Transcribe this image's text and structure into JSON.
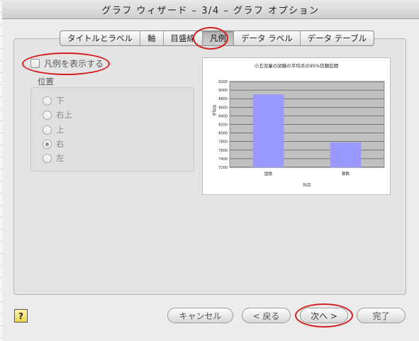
{
  "window": {
    "title": "グラフ ウィザード – 3/4 – グラフ オプション"
  },
  "tabs": [
    {
      "label": "タイトルとラベル"
    },
    {
      "label": "軸"
    },
    {
      "label": "目盛線"
    },
    {
      "label": "凡例"
    },
    {
      "label": "データ ラベル"
    },
    {
      "label": "データ テーブル"
    }
  ],
  "active_tab": "凡例",
  "legend_options": {
    "show_legend_label": "凡例を表示する",
    "show_legend_checked": false,
    "position_group_label": "位置",
    "positions": [
      {
        "label": "下",
        "selected": false
      },
      {
        "label": "右上",
        "selected": false
      },
      {
        "label": "上",
        "selected": false
      },
      {
        "label": "右",
        "selected": true
      },
      {
        "label": "左",
        "selected": false
      }
    ]
  },
  "chart_data": {
    "type": "bar",
    "title": "小五児童の試験の平均点の95%信頼区間",
    "xlabel": "科目",
    "ylabel": "平均点",
    "categories": [
      "国語",
      "算数"
    ],
    "values": [
      8900,
      7780
    ],
    "ylim": [
      7200,
      9200
    ],
    "yticks": [
      "7200",
      "7400",
      "7600",
      "7800",
      "8000",
      "8200",
      "8400",
      "8600",
      "8800",
      "9000",
      "9200"
    ],
    "bar_color": "#9999ff",
    "plot_background": "#c0c0c0",
    "grid": true
  },
  "buttons": {
    "help": "?",
    "cancel": "キャンセル",
    "back": "< 戻る",
    "next": "次へ >",
    "finish": "完了"
  },
  "highlight_color": "#d01e1e"
}
